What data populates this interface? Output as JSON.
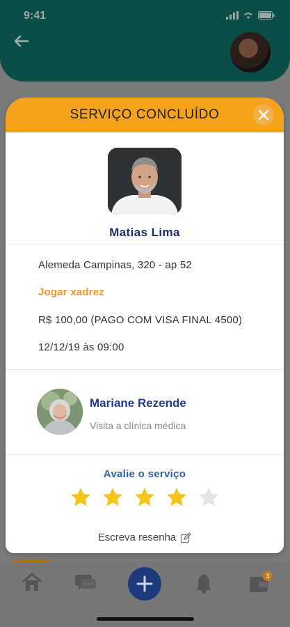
{
  "status_bar": {
    "time": "9:41"
  },
  "modal": {
    "title": "SERVIÇO CONCLUÍDO",
    "professional": {
      "name": "Matias Lima"
    },
    "details": {
      "address": "Alemeda Campinas, 320 - ap 52",
      "service": "Jogar xadrez",
      "payment": "R$ 100,00 (PAGO COM VISA FINAL 4500)",
      "datetime": "12/12/19 às 09:00"
    },
    "client": {
      "name": "Mariane Rezende",
      "subtitle": "Visita a clínica médica"
    },
    "rating": {
      "label": "Avalie o serviço",
      "value": 4,
      "max": 5
    },
    "review_label": "Escreva resenha"
  },
  "bottom_nav": {
    "items": [
      {
        "icon": "home-icon"
      },
      {
        "icon": "chat-icon"
      },
      {
        "icon": "plus-icon"
      },
      {
        "icon": "bell-icon"
      },
      {
        "icon": "wallet-icon",
        "badge": "3"
      }
    ]
  },
  "colors": {
    "header_bg": "#0a4e47",
    "modal_header": "#f7a21b",
    "name_blue": "#1d2f6b",
    "service_orange": "#f5962b",
    "star_filled": "#f3c41b",
    "star_empty": "#e3e3e3",
    "fab_bg": "#1d3a7a"
  }
}
